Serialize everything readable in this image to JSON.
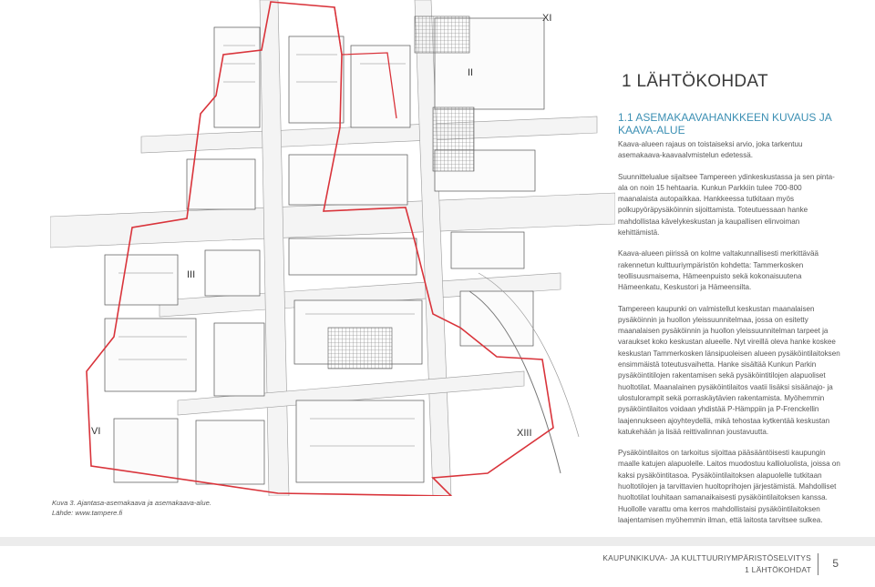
{
  "chapter": {
    "number": "1",
    "title": "LÄHTÖKOHDAT"
  },
  "section": {
    "title": "1.1 ASEMAKAAVAHANKKEEN KUVAUS JA KAAVA-ALUE"
  },
  "paragraphs": [
    "Kaava-alueen rajaus on toistaiseksi arvio, joka tarkentuu asemakaava-kaavaalvmistelun edetessä.",
    "Suunnittelualue sijaitsee Tampereen ydinkeskustassa ja sen pinta-ala on noin 15 hehtaaria. Kunkun Parkkiin tulee 700-800 maanalaista autopaikkaa. Hankkeessa tutkitaan myös polkupyöräpysäköinnin sijoittamista. Toteutuessaan hanke mahdollistaa kävelykeskustan ja kaupallisen elinvoiman kehittämistä.",
    "Kaava-alueen piirissä on kolme valtakunnallisesti merkittävää rakennetun kulttuuriympäristön kohdetta: Tammerkosken teollisuusmaisema, Hämeenpuisto sekä kokonaisuutena Hämeenkatu, Keskustori ja Hämeensilta.",
    "Tampereen kaupunki on valmistellut keskustan maanalaisen pysäköinnin ja huollon yleissuunnitelmaa, jossa on esitetty maanalaisen pysäköinnin ja huollon yleissuunnitelman tarpeet ja varaukset koko keskustan alueelle. Nyt vireillä oleva hanke koskee keskustan Tammerkosken länsipuoleisen alueen pysäköintilaitoksen ensimmäistä toteutusvaihetta. Hanke sisältää Kunkun Parkin pysäköintitilojen rakentamisen sekä pysäköintitilojen alapuoliset huoltotilat. Maanalainen pysäköintilaitos vaatii lisäksi sisäänajo- ja ulostulorampit sekä porraskäytävien rakentamista. Myöhemmin pysäköintilaitos voidaan yhdistää P-Hämppiin ja P-Frenckellin laajennukseen ajoyhteydellä, mikä tehostaa kytkentää keskustan katukehään ja lisää reittivalinnan joustavuutta.",
    "Pysäköintilaitos on tarkoitus sijoittaa pääsääntöisesti kaupungin maalle katujen alapuolelle. Laitos muodostuu kallioluolista, joissa on kaksi pysäköintitasoa. Pysäköintilaitoksen alapuolelle tutkitaan huoltotilojen ja tarvittavien huoltoprihojen järjestämistä. Mahdolliset huoltotilat louhitaan samanaikaisesti pysäköintilaitoksen kanssa. Huollolle varattu oma kerros mahdollistaisi pysäköintilaitoksen laajentamisen myöhemmin ilman, että laitosta tarvitsee sulkea."
  ],
  "caption": {
    "line1": "Kuva 3. Ajantasa-asemakaava ja asemakaava-alue.",
    "line2": "Lähde: www.tampere.fi"
  },
  "map_labels": {
    "roman_ii": "II",
    "roman_iii": "III",
    "roman_vi": "VI",
    "roman_xi": "XI",
    "roman_xiii": "XIII"
  },
  "footer": {
    "line1": "KAUPUNKIKUVA- JA KULTTUURIYMPÄRISTÖSELVITYS",
    "line2": "1 LÄHTÖKOHDAT",
    "page": "5"
  },
  "colors": {
    "accent": "#3b8fb3",
    "boundary": "#d9343b",
    "footer_bar": "#ececec"
  }
}
